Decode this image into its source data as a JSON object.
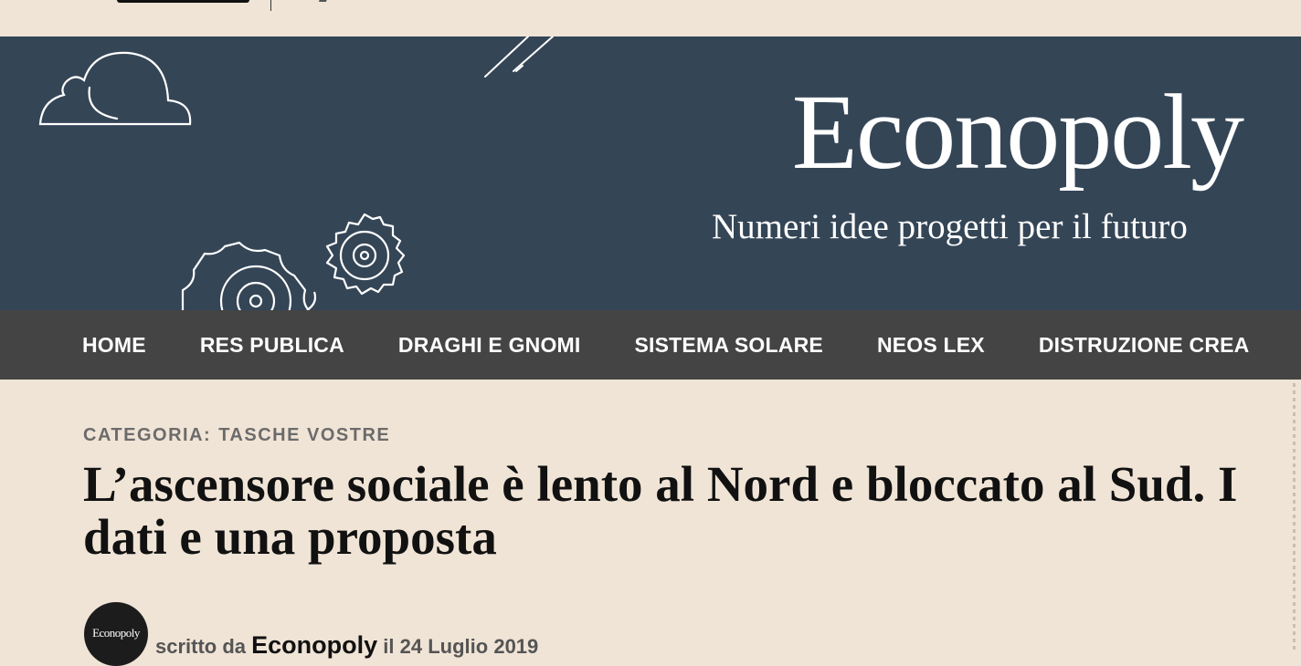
{
  "header": {
    "title": "Econopoly",
    "tagline": "Numeri idee progetti per il futuro"
  },
  "nav": {
    "items": [
      "HOME",
      "RES PUBLICA",
      "DRAGHI E GNOMI",
      "SISTEMA SOLARE",
      "NEOS LEX",
      "DISTRUZIONE CREA"
    ]
  },
  "article": {
    "category_label": "CATEGORIA:",
    "category": "TASCHE VOSTRE",
    "title": "L’ascensore sociale è lento al Nord e bloccato al Sud. I dati e una proposta",
    "byline_prefix": "scritto da",
    "author": "Econopoly",
    "date_prefix": "il",
    "date": "24 Luglio 2019",
    "avatar_text": "Econopoly"
  },
  "colors": {
    "hero_bg": "#344556",
    "nav_bg": "#444444",
    "page_bg": "#f0e4d6"
  },
  "icons": [
    "cloud-icon",
    "gear-icon",
    "rain-lines-icon"
  ]
}
